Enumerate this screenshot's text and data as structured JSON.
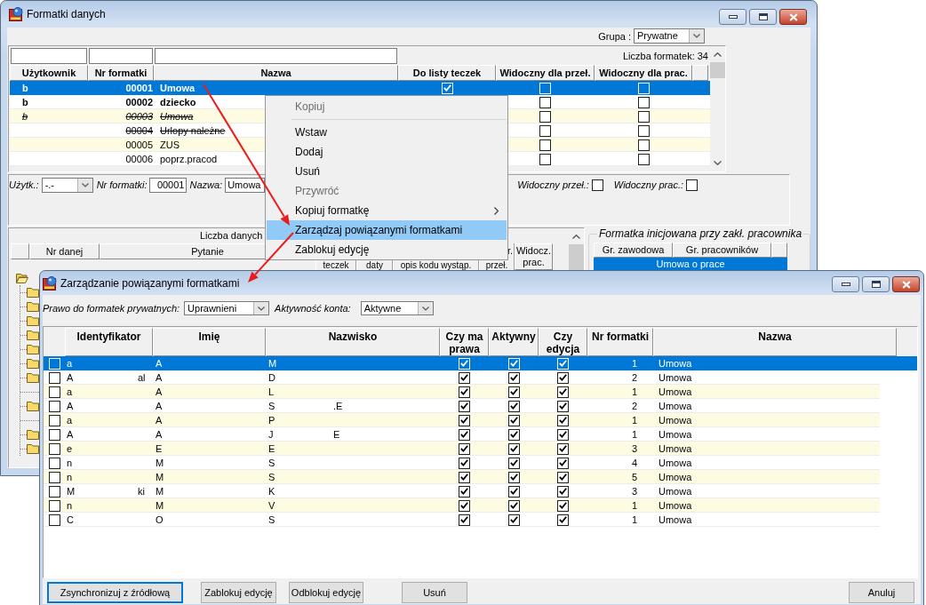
{
  "main_window": {
    "title": "Formatki danych",
    "group_filter": {
      "label": "Grupa :",
      "value": "Prywatne"
    },
    "formats_table": {
      "count": "Liczba formatek: 34",
      "columns": [
        "Użytkownik",
        "Nr formatki",
        "Nazwa",
        "Do listy teczek",
        "Widoczny dla przeł.",
        "Widoczny dla prac."
      ],
      "rows": [
        {
          "user": "b",
          "number": "00001",
          "name": "Umowa",
          "selected": true,
          "bold": true,
          "italic": false,
          "deleted": false,
          "in_folder_list": true,
          "visible_supervisor": false,
          "visible_employee": false
        },
        {
          "user": "b",
          "number": "00002",
          "name": "dziecko",
          "selected": false,
          "bold": true,
          "italic": false,
          "deleted": false,
          "visible_supervisor": false,
          "visible_employee": false
        },
        {
          "user": "b",
          "number": "00003",
          "name": "Umowa",
          "selected": false,
          "bold": false,
          "italic": true,
          "deleted": true,
          "visible_supervisor": false,
          "visible_employee": false
        },
        {
          "number": "00004",
          "name": "Urlopy należne",
          "selected": false,
          "bold": false,
          "italic": false,
          "deleted": true,
          "visible_supervisor": false,
          "visible_employee": false
        },
        {
          "number": "00005",
          "name": "ZUS",
          "selected": false,
          "bold": false,
          "italic": false,
          "deleted": false,
          "visible_supervisor": false,
          "visible_employee": false
        },
        {
          "number": "00006",
          "name": "poprz.pracod",
          "selected": false,
          "bold": false,
          "italic": false,
          "deleted": false,
          "visible_supervisor": false,
          "visible_employee": false
        }
      ]
    },
    "details": {
      "user": {
        "label": "Użytk.:",
        "value": "-.-"
      },
      "number": {
        "label": "Nr formatki:",
        "value": "00001"
      },
      "name": {
        "label": "Nazwa:",
        "value": "Umowa"
      },
      "flags": [
        {
          "label": "Widoczny przeł.:",
          "checked": false
        },
        {
          "label": "Widoczny prac.:",
          "checked": false
        }
      ]
    },
    "data_panel": {
      "count_label": "Liczba danych",
      "columns": [
        {
          "kind": "short",
          "label": "Nr danej"
        },
        {
          "kind": "short",
          "label": "Pytanie"
        },
        {
          "kind": "covered",
          "label": "teczek"
        },
        {
          "kind": "covered",
          "label": "daty"
        },
        {
          "kind": "covered",
          "label": "opis kodu wystąp."
        },
        {
          "kind": "covered",
          "top": "r.",
          "label": "przeł."
        },
        {
          "kind": "tall",
          "label": "Widocz. prac."
        }
      ]
    },
    "init_group": {
      "title": "Formatka inicjowana przy zakł. pracownika",
      "columns": [
        "Gr. zawodowa",
        "Gr. pracowników"
      ],
      "rows": [
        {
          "text": "Umowa o prace",
          "selected": true
        }
      ]
    }
  },
  "context_menu": {
    "items": [
      {
        "kind": "item",
        "label": "Kopiuj",
        "disabled": true,
        "selected": false,
        "submenu": false
      },
      {
        "kind": "separator"
      },
      {
        "kind": "item",
        "label": "Wstaw",
        "disabled": false,
        "selected": false,
        "submenu": false
      },
      {
        "kind": "item",
        "label": "Dodaj",
        "disabled": false,
        "selected": false,
        "submenu": false
      },
      {
        "kind": "item",
        "label": "Usuń",
        "disabled": false,
        "selected": false,
        "submenu": false
      },
      {
        "kind": "item",
        "label": "Przywróć",
        "disabled": true,
        "selected": false,
        "submenu": false
      },
      {
        "kind": "item",
        "label": "Kopiuj formatkę",
        "disabled": false,
        "selected": false,
        "submenu": true
      },
      {
        "kind": "item",
        "label": "Zarządzaj powiązanymi formatkami",
        "disabled": false,
        "selected": true,
        "submenu": false
      },
      {
        "kind": "item",
        "label": "Zablokuj edycję",
        "disabled": false,
        "selected": false,
        "submenu": false
      }
    ]
  },
  "dialog": {
    "title": "Zarządzanie powiązanymi formatkami",
    "filters": [
      {
        "label": "Prawo do formatek prywatnych:",
        "value": "Uprawnieni"
      },
      {
        "label": "Aktywność konta:",
        "value": "Aktywne"
      }
    ],
    "table": {
      "columns": [
        "Identyfikator",
        "Imię",
        "Nazwisko",
        "Czy ma prawa",
        "Aktywny",
        "Czy edycja",
        "Nr formatki",
        "Nazwa"
      ],
      "rows": [
        {
          "selected": true,
          "marked": false,
          "identifier": [
            "a"
          ],
          "first_name": "A",
          "last_name": [
            "M"
          ],
          "has_rights": true,
          "active": true,
          "editing": true,
          "number": "1",
          "name": "Umowa"
        },
        {
          "selected": false,
          "marked": false,
          "identifier": [
            "A",
            "al"
          ],
          "first_name": "A",
          "last_name": [
            "D"
          ],
          "has_rights": true,
          "active": true,
          "editing": true,
          "number": "2",
          "name": "Umowa"
        },
        {
          "selected": false,
          "marked": false,
          "identifier": [
            "a"
          ],
          "first_name": "A",
          "last_name": [
            "L"
          ],
          "has_rights": true,
          "active": true,
          "editing": true,
          "number": "1",
          "name": "Umowa"
        },
        {
          "selected": false,
          "marked": false,
          "identifier": [
            "A"
          ],
          "first_name": "A",
          "last_name": [
            "S",
            ".E"
          ],
          "has_rights": true,
          "active": true,
          "editing": true,
          "number": "2",
          "name": "Umowa"
        },
        {
          "selected": false,
          "marked": false,
          "identifier": [
            "a"
          ],
          "first_name": "A",
          "last_name": [
            "P"
          ],
          "has_rights": true,
          "active": true,
          "editing": true,
          "number": "1",
          "name": "Umowa"
        },
        {
          "selected": false,
          "marked": false,
          "identifier": [
            "A"
          ],
          "first_name": "A",
          "last_name": [
            "J",
            "E"
          ],
          "has_rights": true,
          "active": true,
          "editing": true,
          "number": "1",
          "name": "Umowa"
        },
        {
          "selected": false,
          "marked": false,
          "identifier": [
            "e"
          ],
          "first_name": "E",
          "last_name": [
            "E"
          ],
          "has_rights": true,
          "active": true,
          "editing": true,
          "number": "3",
          "name": "Umowa"
        },
        {
          "selected": false,
          "marked": false,
          "identifier": [
            "n"
          ],
          "first_name": "M",
          "last_name": [
            "S"
          ],
          "has_rights": true,
          "active": true,
          "editing": true,
          "number": "4",
          "name": "Umowa"
        },
        {
          "selected": false,
          "marked": false,
          "identifier": [
            "n"
          ],
          "first_name": "M",
          "last_name": [
            "S"
          ],
          "has_rights": true,
          "active": true,
          "editing": true,
          "number": "5",
          "name": "Umowa"
        },
        {
          "selected": false,
          "marked": false,
          "identifier": [
            "M",
            "ki"
          ],
          "first_name": "M",
          "last_name": [
            "K"
          ],
          "has_rights": true,
          "active": true,
          "editing": true,
          "number": "3",
          "name": "Umowa"
        },
        {
          "selected": false,
          "marked": false,
          "identifier": [
            "n"
          ],
          "first_name": "M",
          "last_name": [
            "V"
          ],
          "has_rights": true,
          "active": true,
          "editing": true,
          "number": "1",
          "name": "Umowa"
        },
        {
          "selected": false,
          "marked": false,
          "identifier": [
            "C"
          ],
          "first_name": "O",
          "last_name": [
            "S"
          ],
          "has_rights": true,
          "active": true,
          "editing": true,
          "number": "1",
          "name": "Umowa"
        }
      ]
    },
    "buttons": [
      {
        "label": "Zsynchronizuj z źródłową",
        "focused": true
      },
      {
        "label": "Zablokuj edycję",
        "focused": false
      },
      {
        "label": "Odblokuj edycję",
        "focused": false
      },
      {
        "label": "Usuń",
        "focused": false
      },
      {
        "label": "Anuluj",
        "focused": false
      }
    ]
  }
}
